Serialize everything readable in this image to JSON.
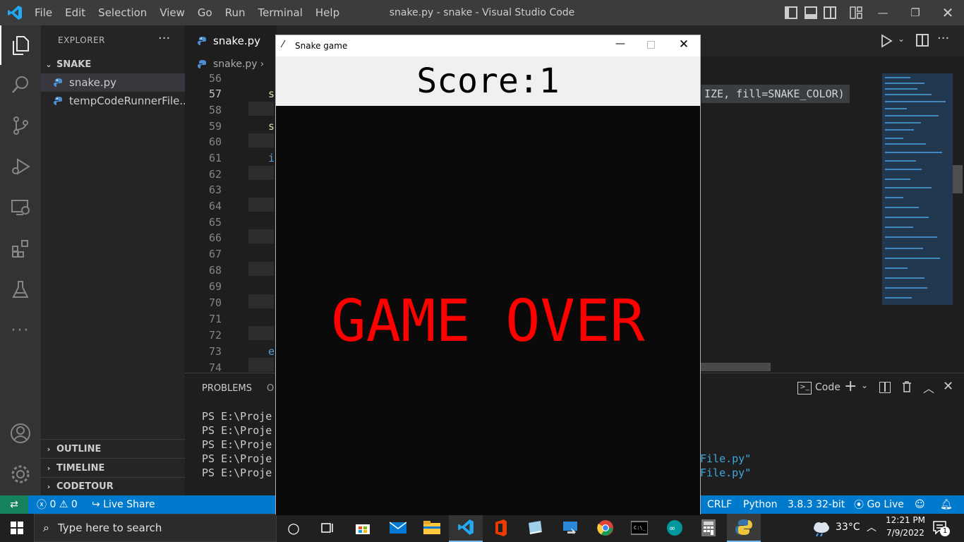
{
  "titlebar": {
    "menu": [
      "File",
      "Edit",
      "Selection",
      "View",
      "Go",
      "Run",
      "Terminal",
      "Help"
    ],
    "window_title": "snake.py - snake - Visual Studio Code"
  },
  "sidebar": {
    "header": "EXPLORER",
    "folder": "SNAKE",
    "files": [
      "snake.py",
      "tempCodeRunnerFile...."
    ],
    "sections": [
      "OUTLINE",
      "TIMELINE",
      "CODETOUR"
    ]
  },
  "editor": {
    "tab_label": "snake.py",
    "breadcrumb": "snake.py",
    "line_numbers": [
      "56",
      "57",
      "58",
      "59",
      "60",
      "61",
      "62",
      "63",
      "64",
      "65",
      "66",
      "67",
      "68",
      "69",
      "70",
      "71",
      "72",
      "73",
      "74"
    ],
    "visible_code_tail": "IZE, fill=SNAKE_COLOR)",
    "code_fragments": {
      "l57": "s",
      "l59": "s",
      "l61": "i",
      "l73": "e"
    }
  },
  "panel": {
    "tab_problems": "PROBLEMS",
    "tab_output_partial": "O",
    "terminal_name": "Code",
    "terminal_lines": [
      "PS E:\\Proje",
      "PS E:\\Proje",
      "PS E:\\Proje",
      "PS E:\\Proje",
      "PS E:\\Proje"
    ],
    "terminal_tails": [
      "File.py\"",
      "File.py\""
    ]
  },
  "statusbar": {
    "errors": "0",
    "warnings": "0",
    "live_share": "Live Share",
    "eol": "CRLF",
    "language": "Python",
    "interpreter": "3.8.3 32-bit",
    "go_live": "Go Live"
  },
  "game": {
    "window_title": "Snake game",
    "score_text": "Score:1",
    "game_over_text": "GAME OVER"
  },
  "taskbar": {
    "search_placeholder": "Type here to search",
    "temperature": "33°C",
    "time": "12:21 PM",
    "date": "7/9/2022",
    "notification_count": "1"
  }
}
